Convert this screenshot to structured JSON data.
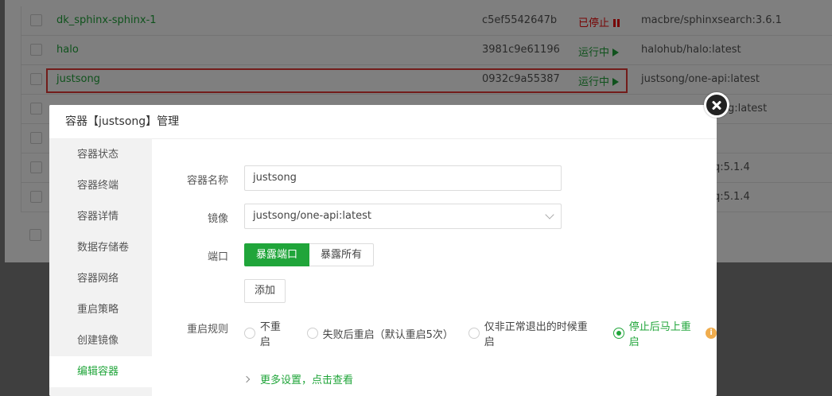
{
  "table": {
    "rows": [
      {
        "name": "dk_sphinx-sphinx-1",
        "id": "c5ef5542647b",
        "status": "已停止",
        "status_type": "stopped",
        "image": "macbre/sphinxsearch:3.6.1"
      },
      {
        "name": "halo",
        "id": "3981c9e61196",
        "status": "运行中",
        "status_type": "running",
        "image": "halohub/halo:latest"
      },
      {
        "name": "justsong",
        "id": "0932c9a55387",
        "status": "运行中",
        "status_type": "running",
        "image": "justsong/one-api:latest"
      },
      {
        "name": "",
        "id": "",
        "status": "",
        "status_type": "",
        "image": "g:latest"
      },
      {
        "name": "",
        "id": "",
        "status": "",
        "status_type": "",
        "image": ""
      },
      {
        "name": "",
        "id": "",
        "status": "",
        "status_type": "",
        "image": "q:5.1.4"
      },
      {
        "name": "",
        "id": "",
        "status": "",
        "status_type": "",
        "image": "q:5.1.4"
      }
    ]
  },
  "modal": {
    "title": "容器【justsong】管理",
    "sidebar": [
      "容器状态",
      "容器终端",
      "容器详情",
      "数据存储卷",
      "容器网络",
      "重启策略",
      "创建镜像",
      "编辑容器"
    ],
    "active_index": 7,
    "form": {
      "name_label": "容器名称",
      "name_value": "justsong",
      "image_label": "镜像",
      "image_value": "justsong/one-api:latest",
      "port_label": "端口",
      "port_expose": "暴露端口",
      "port_expose_all": "暴露所有",
      "add_label": "添加",
      "restart_label": "重启规则",
      "restart_options": [
        "不重启",
        "失败后重启（默认重启5次）",
        "仅非正常退出的时候重启",
        "停止后马上重启"
      ],
      "restart_selected": 3,
      "more_settings": "更多设置，点击查看"
    }
  },
  "colors": {
    "accent": "#20a53a",
    "stopped": "#ef0808",
    "highlight": "#e53935",
    "info": "#f0ad4e"
  }
}
